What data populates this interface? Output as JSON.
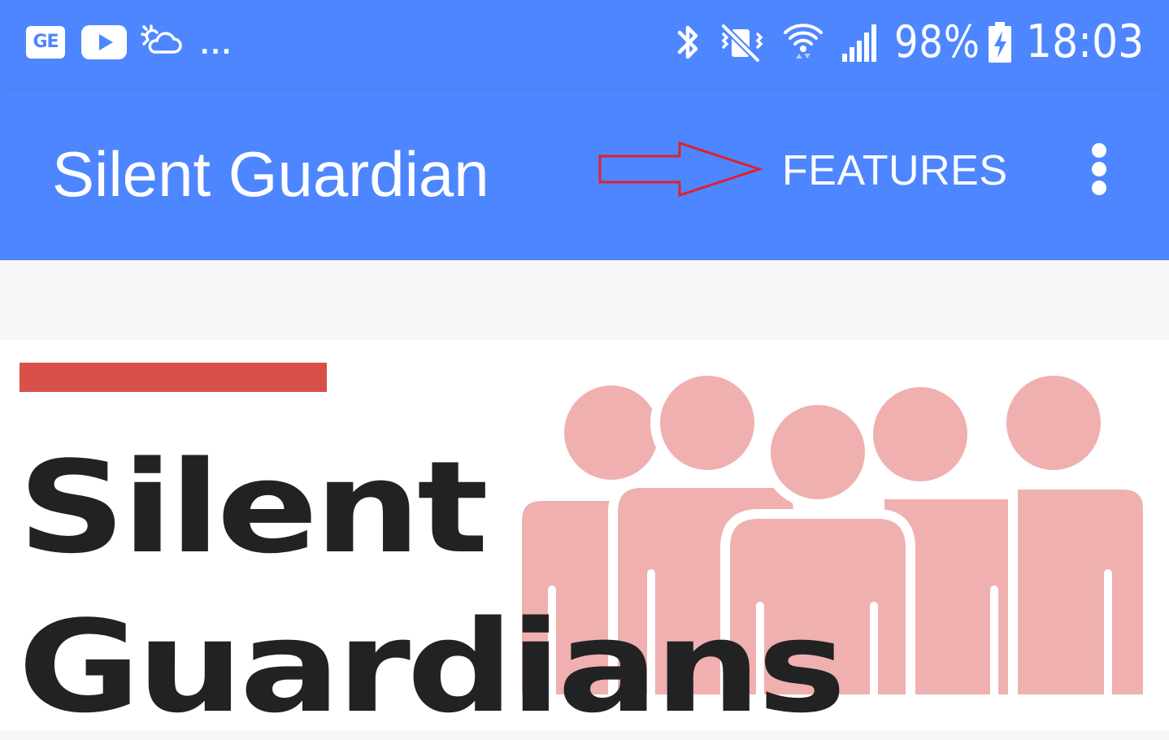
{
  "status_bar": {
    "left_icons": [
      "ge-news-icon",
      "youtube-icon",
      "weather-cloud-sun-icon"
    ],
    "ge_label": "GE",
    "overflow": "...",
    "right_icons": [
      "bluetooth-icon",
      "vibrate-mute-icon",
      "wifi-icon",
      "cellular-signal-icon",
      "battery-charging-icon"
    ],
    "battery_percent": "98%",
    "time": "18:03",
    "color": "#4d86ff"
  },
  "app_bar": {
    "title": "Silent Guardian",
    "features_label": "FEATURES",
    "overflow_icon": "more-vert-icon",
    "color": "#4d86ff",
    "annotation_color": "#e0202a"
  },
  "banner": {
    "line1": "Silent",
    "line2": "Guardians",
    "accent_color": "#d8504a",
    "people_color": "#f0b0b0",
    "text_color": "#222222"
  }
}
